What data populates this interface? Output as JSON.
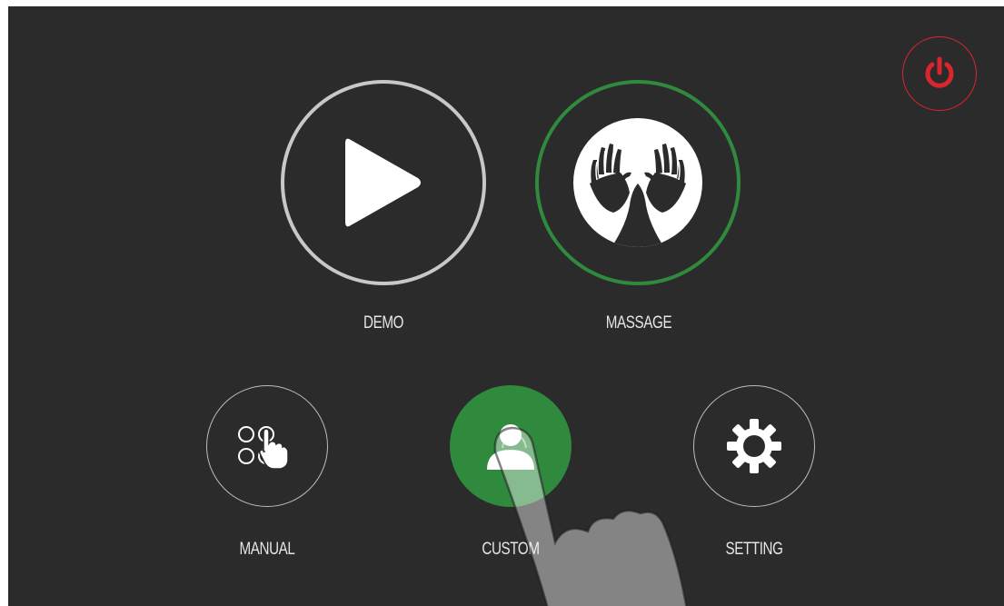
{
  "screen": {
    "background": "#2b2b2b",
    "accent": "#2f8a3e",
    "power_color": "#d8262c"
  },
  "power": {
    "icon": "power-icon"
  },
  "modes": {
    "demo": {
      "label": "DEMO",
      "icon": "play-icon"
    },
    "massage": {
      "label": "MASSAGE",
      "icon": "massage-hands-icon",
      "selected": true
    }
  },
  "menu": {
    "manual": {
      "label": "MANUAL",
      "icon": "manual-touch-icon"
    },
    "custom": {
      "label": "CUSTOM",
      "icon": "user-icon",
      "active": true
    },
    "setting": {
      "label": "SETTING",
      "icon": "gear-icon"
    }
  },
  "overlay": {
    "icon": "pointing-finger-icon"
  }
}
